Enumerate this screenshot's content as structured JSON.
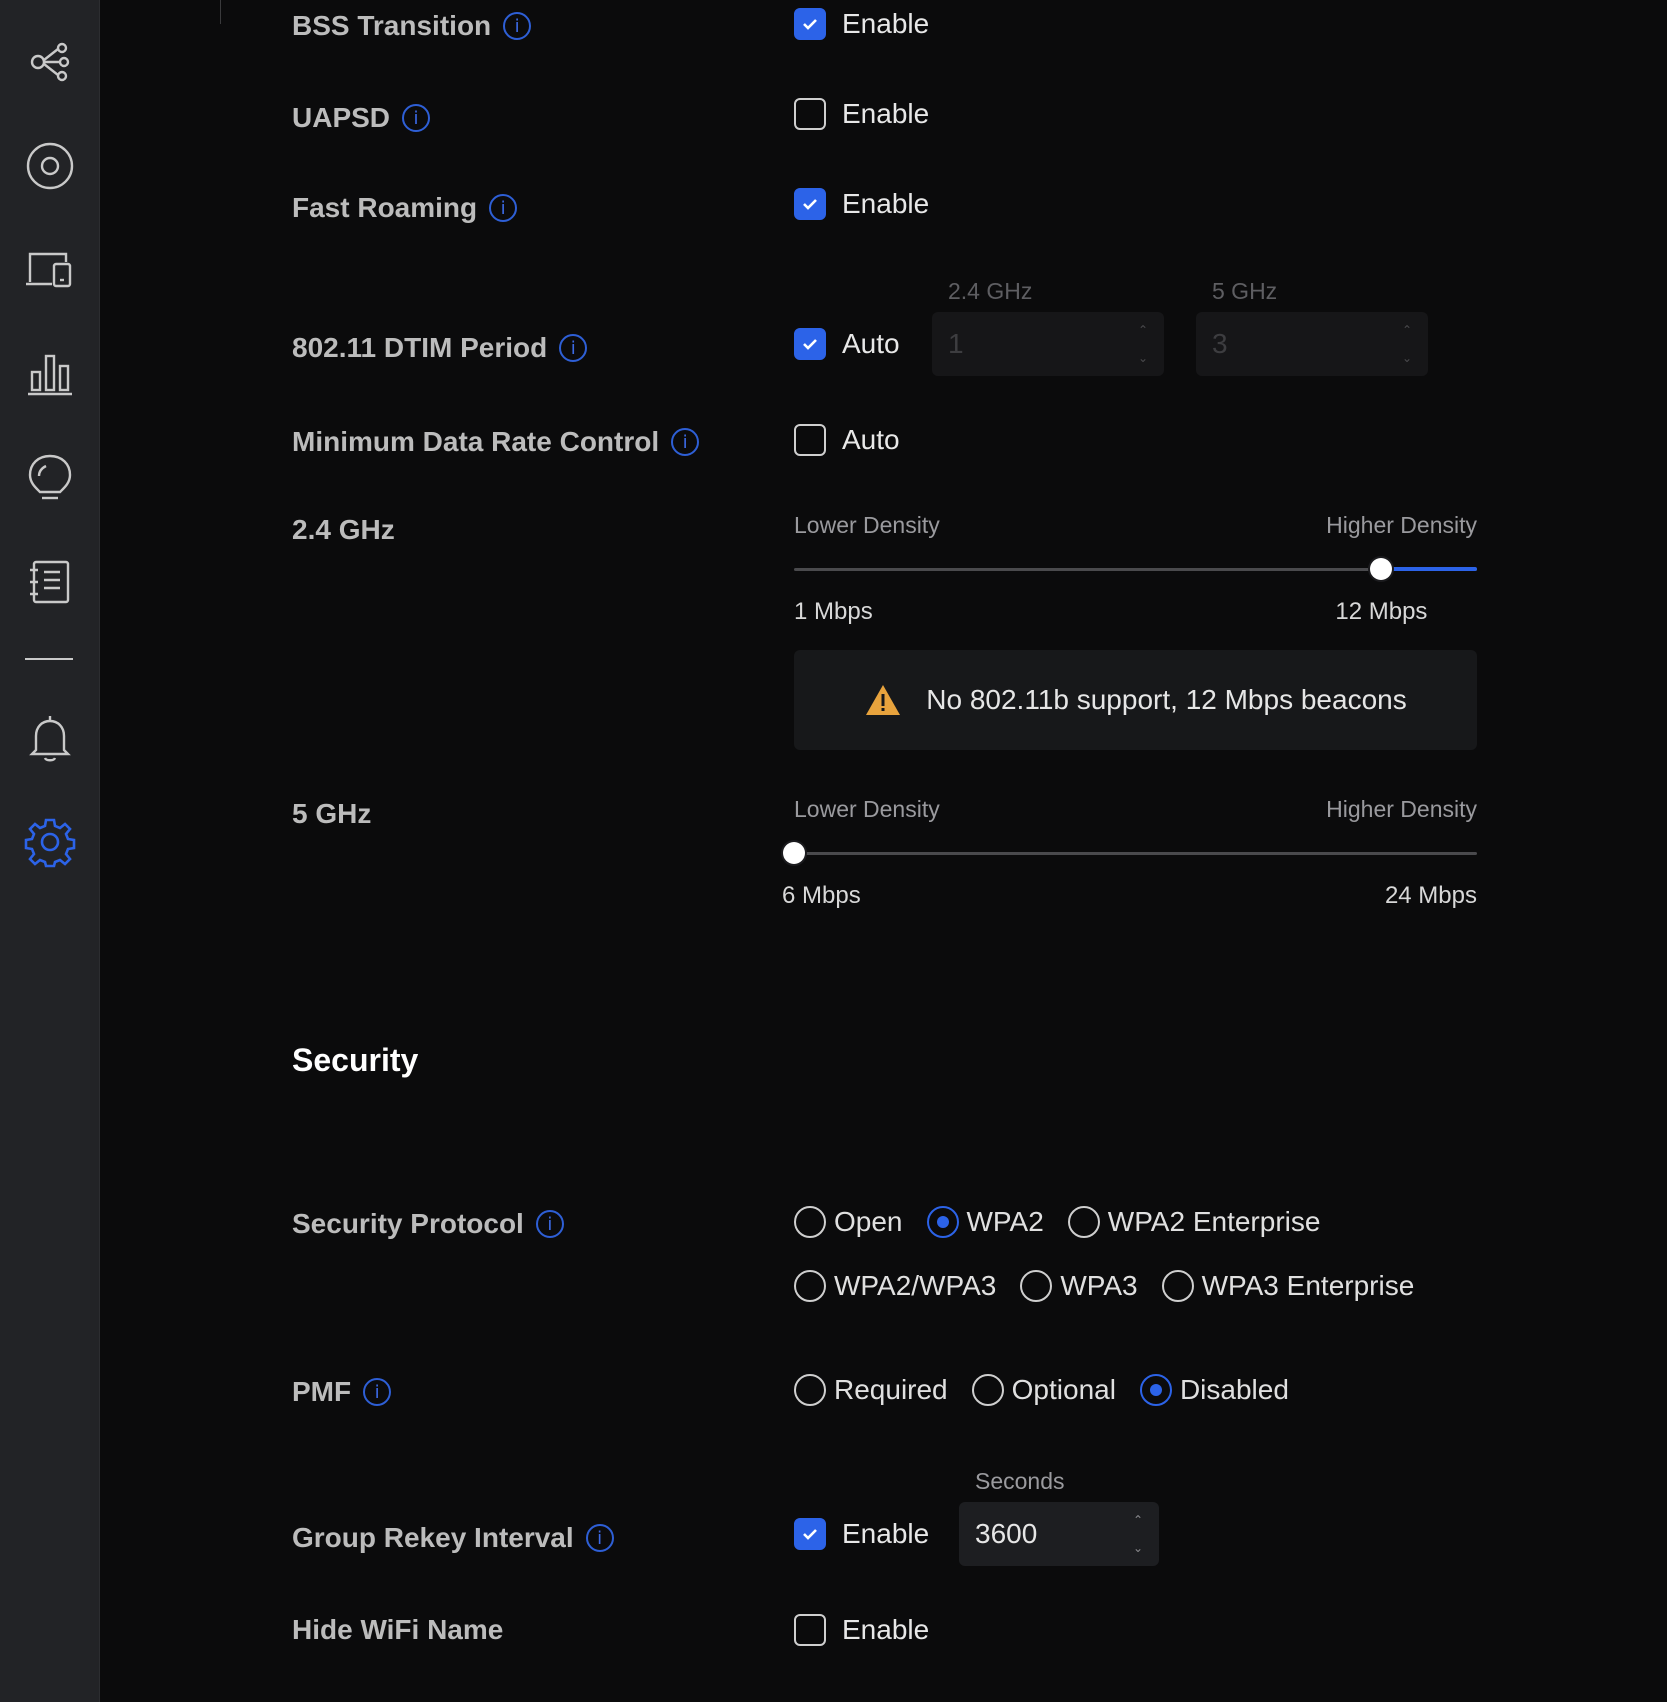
{
  "sidebar": {
    "icons": [
      "topology-icon",
      "target-icon",
      "devices-icon",
      "bar-chart-icon",
      "lightbulb-icon",
      "notebook-icon",
      "bell-icon",
      "gear-icon"
    ],
    "active": "gear-icon",
    "active_color": "#2c63e8"
  },
  "settings": {
    "bss_transition": {
      "label": "BSS Transition",
      "option": "Enable",
      "checked": true
    },
    "uapsd": {
      "label": "UAPSD",
      "option": "Enable",
      "checked": false
    },
    "fast_roaming": {
      "label": "Fast Roaming",
      "option": "Enable",
      "checked": true
    },
    "dtim": {
      "label": "802.11 DTIM Period",
      "option": "Auto",
      "checked": true,
      "field_24_title": "2.4 GHz",
      "field_24_value": "1",
      "field_5_title": "5 GHz",
      "field_5_value": "3"
    },
    "min_rate": {
      "label": "Minimum Data Rate Control",
      "option": "Auto",
      "checked": false
    },
    "band_24": {
      "label": "2.4 GHz",
      "lower": "Lower Density",
      "higher": "Higher Density",
      "min_label": "1 Mbps",
      "value_label": "12 Mbps",
      "value_fraction": 0.86,
      "warning": "No 802.11b support, 12 Mbps beacons"
    },
    "band_5": {
      "label": "5 GHz",
      "lower": "Lower Density",
      "higher": "Higher Density",
      "min_label": "6 Mbps",
      "max_label": "24 Mbps",
      "value_fraction": 0.0
    }
  },
  "security": {
    "title": "Security",
    "protocol": {
      "label": "Security Protocol",
      "options": [
        "Open",
        "WPA2",
        "WPA2 Enterprise",
        "WPA2/WPA3",
        "WPA3",
        "WPA3 Enterprise"
      ],
      "selected": "WPA2"
    },
    "pmf": {
      "label": "PMF",
      "options": [
        "Required",
        "Optional",
        "Disabled"
      ],
      "selected": "Disabled"
    },
    "rekey": {
      "label": "Group Rekey Interval",
      "option": "Enable",
      "checked": true,
      "field_title": "Seconds",
      "value": "3600"
    },
    "hide_ssid": {
      "label": "Hide WiFi Name",
      "option": "Enable",
      "checked": false
    }
  }
}
